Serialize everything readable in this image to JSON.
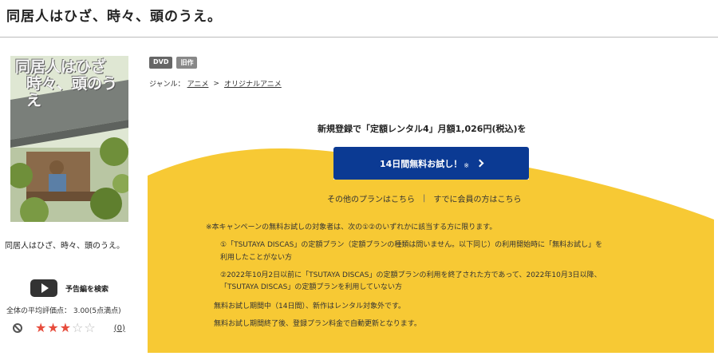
{
  "page": {
    "title": "同居人はひざ、時々、頭のうえ。"
  },
  "cover": {
    "title_line1": "同居人はひざ",
    "title_line2": "時々、頭のうえ",
    "colors": {
      "sky": "#dfe7d3",
      "roof": "#7a7f7a",
      "wood": "#8a6a4a",
      "leaves": "#6f8f3a"
    }
  },
  "left": {
    "work_name": "同居人はひざ、時々、頭のうえ。",
    "trailer_label": "予告編を検索",
    "avg_rating_text": "全体の平均評価点： 3.00(5点満点)",
    "rating_value": 3,
    "rating_max": 5,
    "review_count": "(0)"
  },
  "badges": [
    "DVD",
    "旧作"
  ],
  "genre": {
    "label": "ジャンル：",
    "items": [
      "アニメ",
      "オリジナルアニメ"
    ],
    "separator": ">"
  },
  "promo": {
    "headline": "新規登録で「定額レンタル4」月額1,026円(税込)を",
    "trial_button": "14日間無料お試し！",
    "trial_mark": "※",
    "other_plans": "その他のプランはこちら",
    "link_separator": "|",
    "members_link": "すでに会員の方はこちら",
    "notes": [
      "※本キャンペーンの無料お試しの対象者は、次の①②のいずれかに該当する方に限ります。",
      "①「TSUTAYA DISCAS」の定額プラン（定額プランの種類は問いません。以下同じ）の利用開始時に「無料お試し」を",
      "利用したことがない方",
      "②2022年10月2日以前に「TSUTAYA DISCAS」の定額プランの利用を終了された方であって、2022年10月3日以降、",
      "「TSUTAYA DISCAS」の定額プランを利用していない方",
      "無料お試し期間中（14日間）、新作はレンタル対象外です。",
      "無料お試し期間終了後、登録プラン料金で自動更新となります。"
    ],
    "colors": {
      "yellow": "#f7c934",
      "button": "#0b3a93"
    }
  }
}
